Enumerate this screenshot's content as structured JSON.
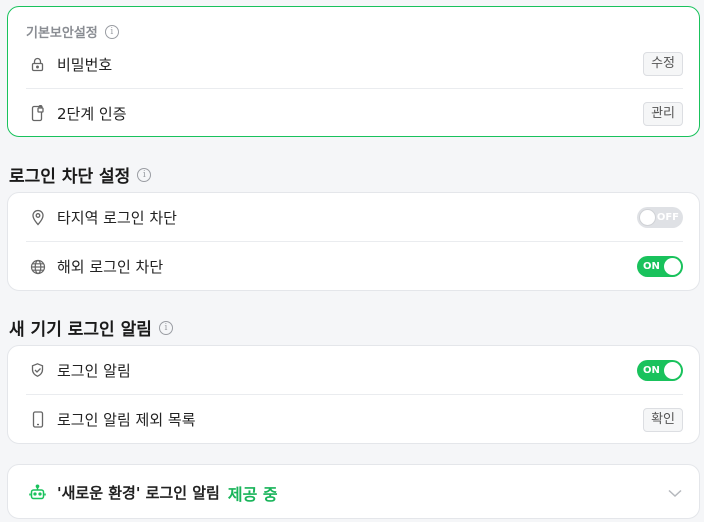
{
  "basic": {
    "heading": "기본보안설정",
    "items": [
      {
        "label": "비밀번호",
        "icon": "lock-icon",
        "action": "수정"
      },
      {
        "label": "2단계 인증",
        "icon": "phone-lock-icon",
        "action": "관리"
      }
    ]
  },
  "login_block": {
    "title": "로그인 차단 설정",
    "items": [
      {
        "label": "타지역 로그인 차단",
        "icon": "location-pin-icon",
        "toggle": "OFF"
      },
      {
        "label": "해외 로그인 차단",
        "icon": "globe-icon",
        "toggle": "ON"
      }
    ]
  },
  "new_device": {
    "title": "새 기기 로그인 알림",
    "items": [
      {
        "label": "로그인 알림",
        "icon": "shield-check-icon",
        "toggle": "ON"
      },
      {
        "label": "로그인 알림 제외 목록",
        "icon": "mobile-icon",
        "action": "확인"
      }
    ]
  },
  "new_env": {
    "label": "'새로운 환경' 로그인 알림",
    "status": "제공 중",
    "icon": "robot-icon"
  },
  "info_glyph": "i",
  "colors": {
    "accent": "#19c25c",
    "border": "#e4e6ea"
  }
}
